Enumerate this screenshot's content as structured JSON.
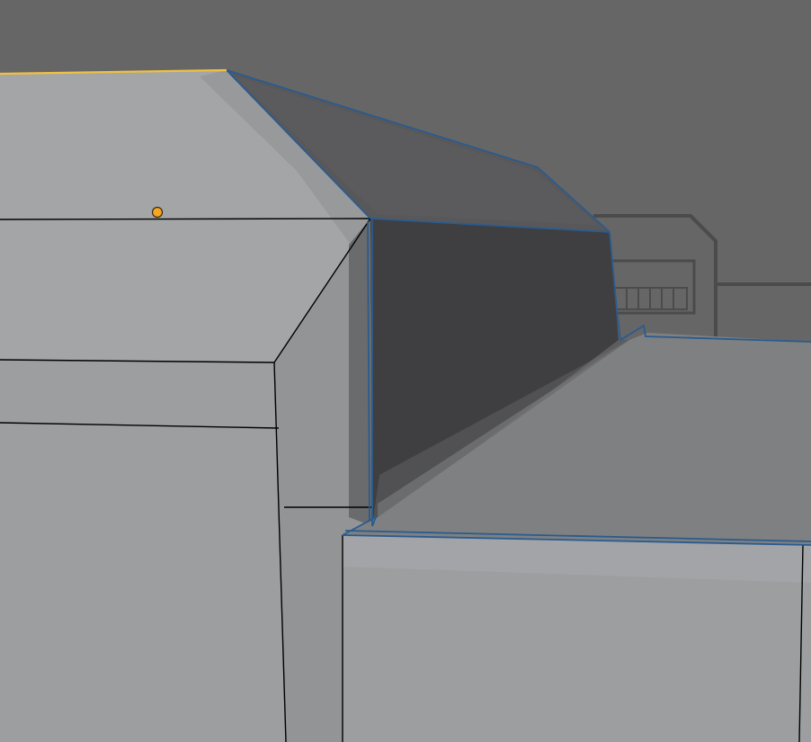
{
  "viewport": {
    "mode": "edit-mode-3d-viewport",
    "background_color": "#666666"
  },
  "colors": {
    "background": "#666666",
    "background_detail_line": "#4b4b4b",
    "face_light": "#9ea0a2",
    "face_mid": "#8f9193",
    "face_right_top": "#7e7f80",
    "face_dark": "#404041",
    "face_selected_slope": "#59595c",
    "wire": "#000000",
    "selected_edge": "#2a5b8f",
    "active_edge": "#f0c040",
    "vertex_origin": "#f5a623"
  },
  "selection": {
    "has_selected_faces": true,
    "has_active_edge": true,
    "has_object_origin": true
  }
}
